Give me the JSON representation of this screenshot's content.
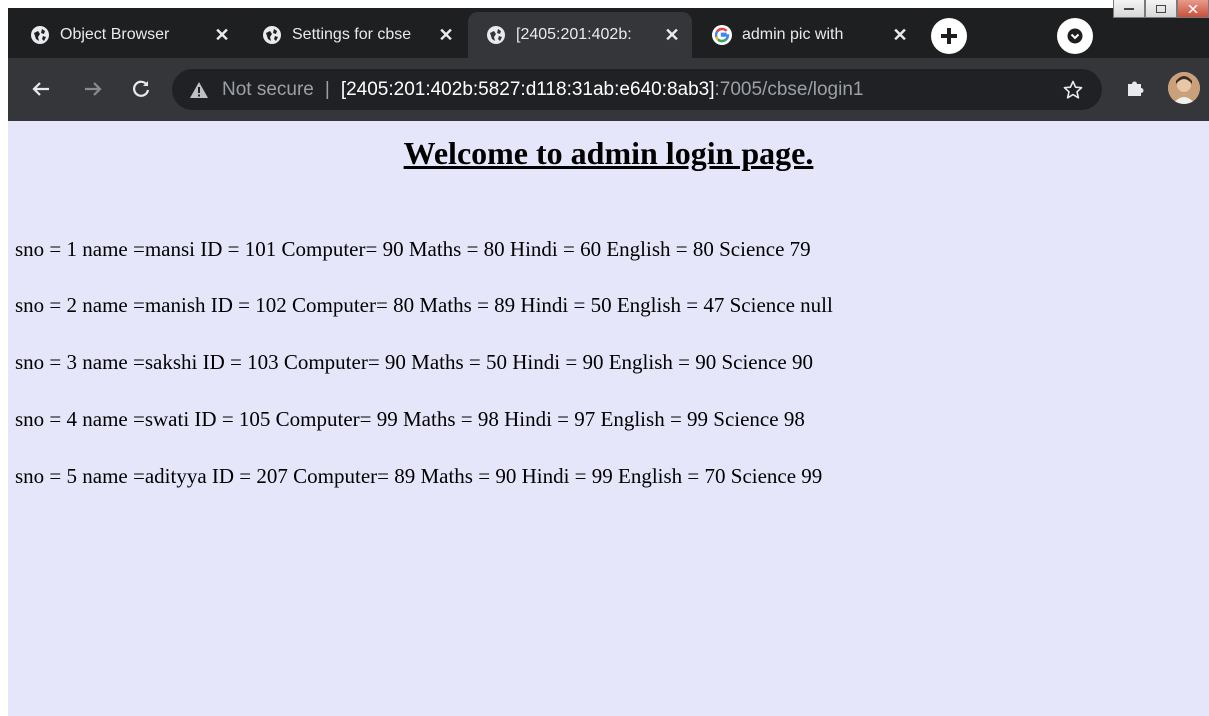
{
  "tabs": [
    {
      "title": "Object Browser",
      "icon": "globe-icon",
      "active": false
    },
    {
      "title": "Settings for cbse",
      "icon": "globe-icon",
      "active": false
    },
    {
      "title": "[2405:201:402b:",
      "icon": "globe-icon",
      "active": true
    },
    {
      "title": "admin pic with",
      "icon": "google-icon",
      "active": false
    }
  ],
  "tab_close_glyph": "✕",
  "toolbar": {
    "not_secure": "Not secure",
    "divider": "|",
    "url_host": "[2405:201:402b:5827:d118:31ab:e640:8ab3]",
    "url_rest": ":7005/cbse/login1"
  },
  "page": {
    "heading": "Welcome to admin login page.",
    "records": [
      "sno = 1 name =mansi ID = 101 Computer= 90 Maths = 80 Hindi = 60 English = 80 Science 79",
      "sno = 2 name =manish ID = 102 Computer= 80 Maths = 89 Hindi = 50 English = 47 Science null",
      "sno = 3 name =sakshi ID = 103 Computer= 90 Maths = 50 Hindi = 90 English = 90 Science 90",
      "sno = 4 name =swati ID = 105 Computer= 99 Maths = 98 Hindi = 97 English = 99 Science 98",
      "sno = 5 name =adityya ID = 207 Computer= 89 Maths = 90 Hindi = 99 English = 70 Science 99"
    ]
  },
  "colors": {
    "page_background": "#e6e6fa",
    "toolbar_background": "#35363a",
    "tabstrip_background": "#1e1f21",
    "omnibox_background": "#202124"
  }
}
